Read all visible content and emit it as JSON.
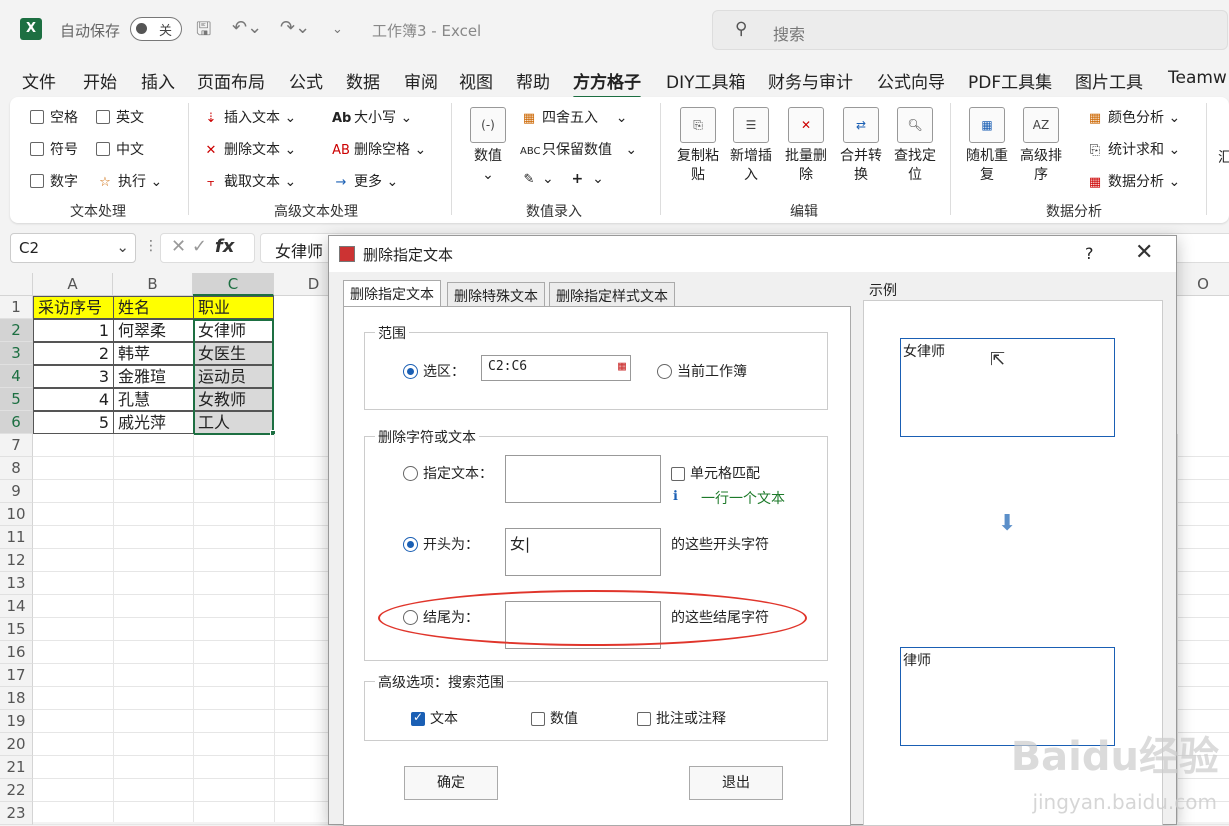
{
  "titlebar": {
    "autosave_label": "自动保存",
    "toggle_state": "关",
    "doc_title": "工作簿3 - Excel",
    "search_placeholder": "搜索"
  },
  "menu": [
    "文件",
    "开始",
    "插入",
    "页面布局",
    "公式",
    "数据",
    "审阅",
    "视图",
    "帮助",
    "方方格子",
    "DIY工具箱",
    "财务与审计",
    "公式向导",
    "PDF工具集",
    "图片工具",
    "Teamw"
  ],
  "ribbon": {
    "text_group": {
      "items": [
        "空格",
        "英文",
        "符号",
        "中文",
        "数字",
        "执行"
      ],
      "label": "文本处理"
    },
    "adv_group": {
      "items": [
        "插入文本",
        "删除文本",
        "截取文本",
        "大小写",
        "删除空格",
        "更多"
      ],
      "label": "高级文本处理"
    },
    "num_group": {
      "big": "数值",
      "items": [
        "四舍五入",
        "只保留数值"
      ],
      "label": "数值录入"
    },
    "edit_group": {
      "items": [
        "复制粘贴",
        "新增插入",
        "批量删除",
        "合并转换",
        "查找定位"
      ],
      "label": "编辑"
    },
    "analysis_group": {
      "items": [
        "随机重复",
        "高级排序",
        "颜色分析",
        "统计求和",
        "数据分析"
      ],
      "label": "数据分析"
    },
    "extra": "汇"
  },
  "formula_bar": {
    "name_box": "C2",
    "fx": "fx",
    "formula": "女律师"
  },
  "sheet": {
    "columns": [
      "A",
      "B",
      "C",
      "D"
    ],
    "rows": [
      "1",
      "2",
      "3",
      "4",
      "5",
      "6",
      "7",
      "8",
      "9",
      "10",
      "11",
      "12",
      "13",
      "14",
      "15",
      "16",
      "17",
      "18",
      "19",
      "20",
      "21",
      "22",
      "23"
    ],
    "header": [
      "采访序号",
      "姓名",
      "职业"
    ],
    "data": [
      [
        "1",
        "何翠柔",
        "女律师"
      ],
      [
        "2",
        "韩苹",
        "女医生"
      ],
      [
        "3",
        "金雅瑄",
        "运动员"
      ],
      [
        "4",
        "孔慧",
        "女教师"
      ],
      [
        "5",
        "戚光萍",
        "工人"
      ]
    ],
    "col_o": "O"
  },
  "dialog": {
    "title": "删除指定文本",
    "help": "?",
    "tabs": [
      "删除指定文本",
      "删除特殊文本",
      "删除指定样式文本"
    ],
    "range_legend": "范围",
    "range_selection_label": "选区：",
    "range_value": "C2:C6",
    "range_workbook_label": "当前工作簿",
    "delete_legend": "删除字符或文本",
    "specify_label": "指定文本：",
    "cell_match_label": "单元格匹配",
    "hint_text": "一行一个文本",
    "starts_label": "开头为：",
    "starts_value": "女",
    "starts_suffix": "的这些开头字符",
    "ends_label": "结尾为：",
    "ends_suffix": "的这些结尾字符",
    "adv_legend": "高级选项：搜索范围",
    "opt_text": "文本",
    "opt_number": "数值",
    "opt_comment": "批注或注释",
    "ok_label": "确定",
    "exit_label": "退出",
    "example_label": "示例",
    "example_before": "女律师",
    "example_after": "律师"
  },
  "watermark": {
    "brand": "Baidu经验",
    "url": "jingyan.baidu.com"
  },
  "colors": {
    "excel_green": "#1d6f42",
    "accent_blue": "#1a5fb4",
    "highlight_red": "#e0352b",
    "header_yellow": "#ffff00"
  }
}
